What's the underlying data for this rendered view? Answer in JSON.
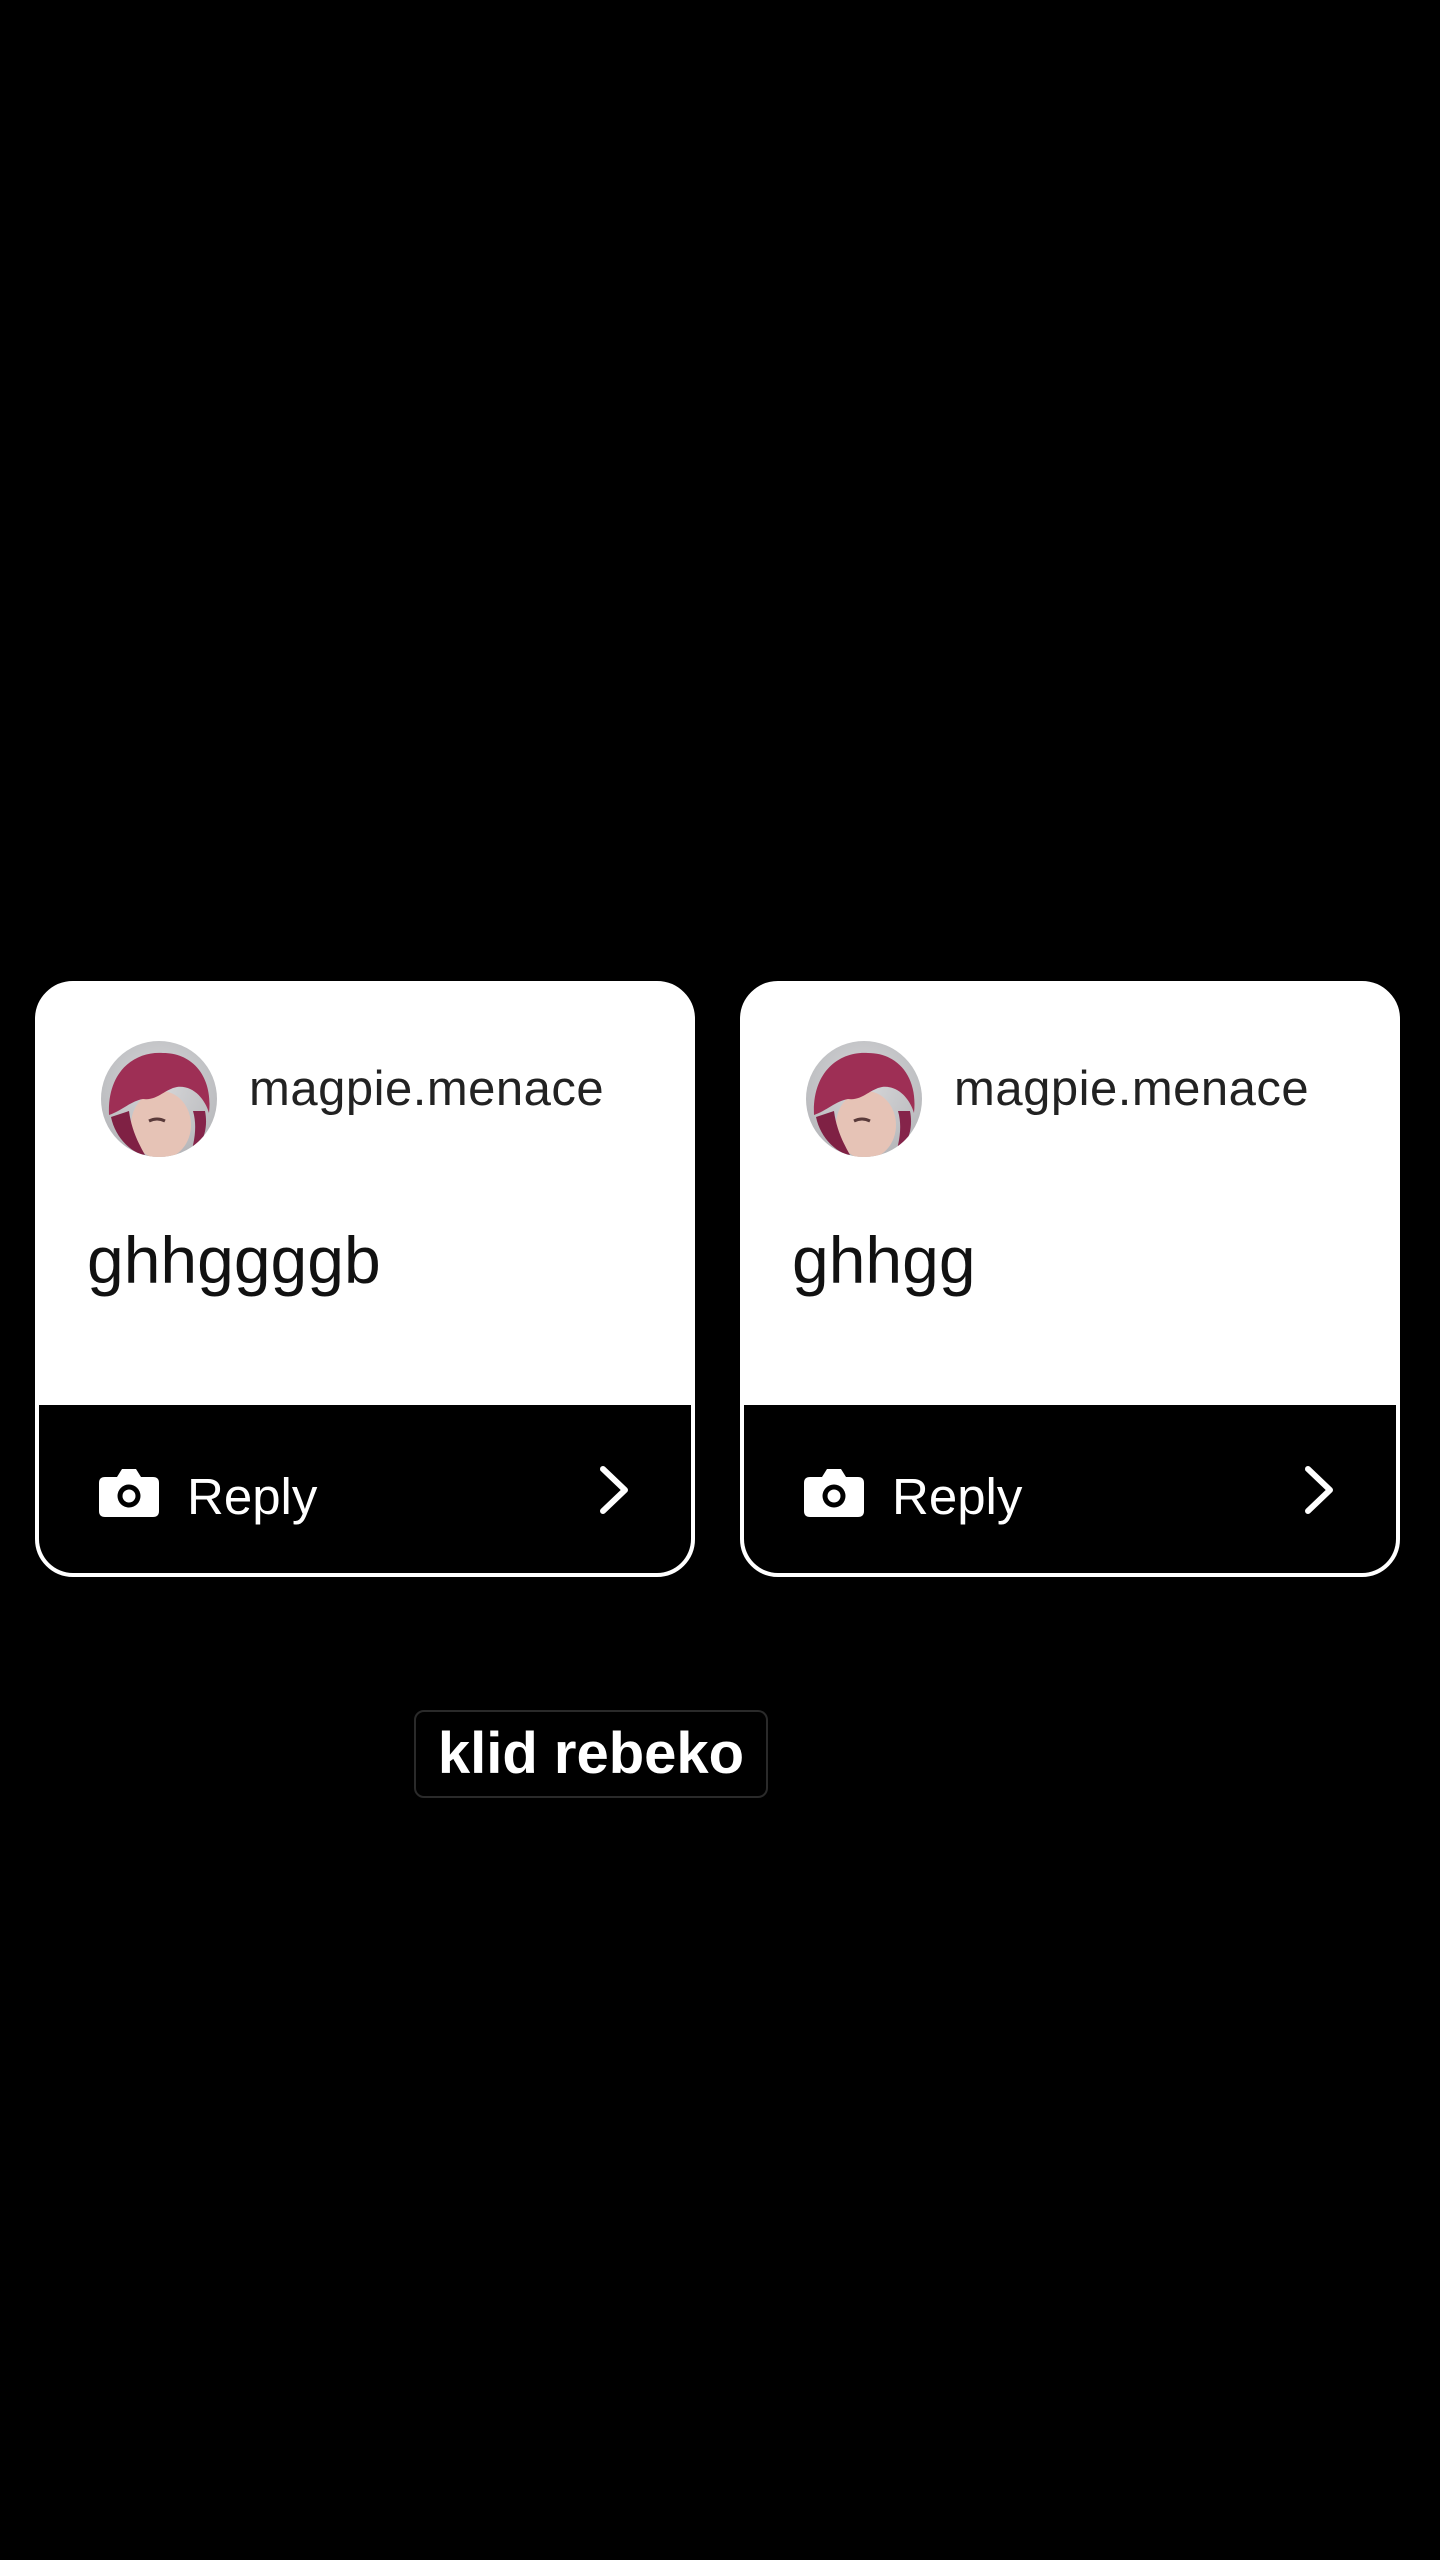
{
  "cards": [
    {
      "username": "magpie.menace",
      "message": "ghhggggb",
      "reply_label": "Reply"
    },
    {
      "username": "magpie.menace",
      "message": "ghhgg",
      "reply_label": "Reply"
    }
  ],
  "caption": "klid rebeko",
  "icons": {
    "reply": "camera-icon",
    "open": "chevron-right-icon",
    "profile": "avatar"
  },
  "colors": {
    "background": "#000000",
    "card": "#ffffff",
    "reply_bar": "#000000",
    "hair_accent": "#9e2f55"
  }
}
